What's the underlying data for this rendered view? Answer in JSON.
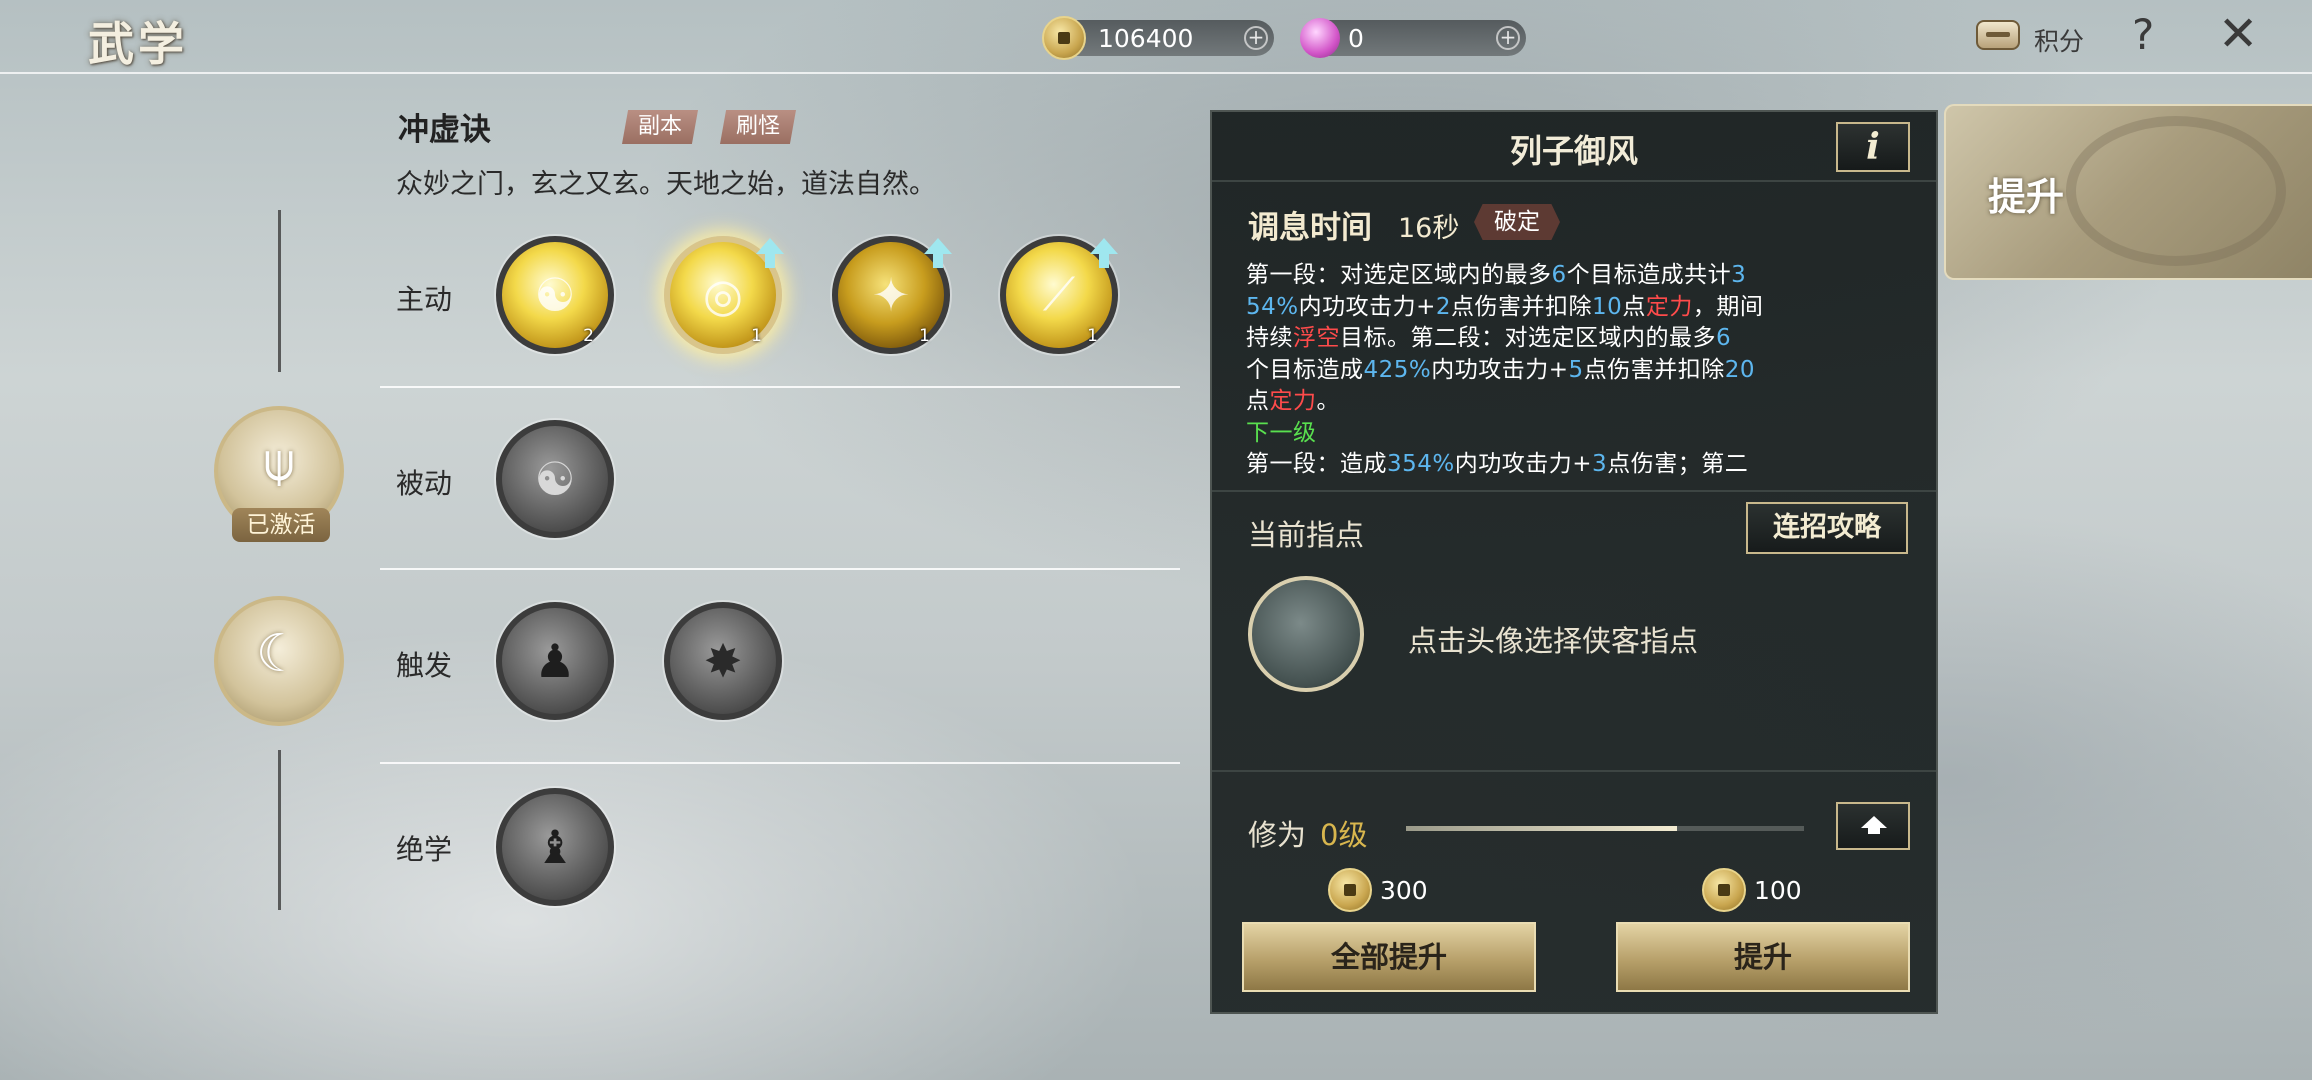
{
  "header": {
    "title": "武学",
    "coins": "106400",
    "gems": "0",
    "points_label": "积分",
    "help_label": "?",
    "close_label": "✕"
  },
  "skill_set": {
    "name": "冲虚诀",
    "tags": [
      "副本",
      "刷怪"
    ],
    "description": "众妙之门，玄之又玄。天地之始，道法自然。",
    "activated_label": "已激活"
  },
  "rows": {
    "active": {
      "label": "主动",
      "skills": [
        {
          "icon": "lightning-taichi-icon",
          "level": "2",
          "upgradable": false
        },
        {
          "icon": "golden-swirl-icon",
          "level": "1",
          "upgradable": true
        },
        {
          "icon": "golden-beast-icon",
          "level": "1",
          "upgradable": true
        },
        {
          "icon": "sword-slash-icon",
          "level": "1",
          "upgradable": true
        }
      ]
    },
    "passive": {
      "label": "被动",
      "skills": [
        {
          "icon": "yin-yang-icon"
        }
      ]
    },
    "trigger": {
      "label": "触发",
      "skills": [
        {
          "icon": "shadow-figure-icon"
        },
        {
          "icon": "cracked-rock-icon"
        }
      ]
    },
    "ultimate": {
      "label": "绝学",
      "skills": [
        {
          "icon": "meditating-master-icon"
        }
      ]
    }
  },
  "panel": {
    "title": "列子御风",
    "info_label": "i",
    "cooldown_label": "调息时间",
    "cooldown_value": "16秒",
    "break_tag": "破定",
    "description_lines": [
      [
        {
          "t": "第一段：对选定区域内的最多",
          "c": ""
        },
        {
          "t": "6",
          "c": "b"
        },
        {
          "t": "个目标造成共计",
          "c": ""
        },
        {
          "t": "3",
          "c": "b"
        }
      ],
      [
        {
          "t": "54%",
          "c": "b"
        },
        {
          "t": "内功攻击力+",
          "c": ""
        },
        {
          "t": "2",
          "c": "b"
        },
        {
          "t": "点伤害并扣除",
          "c": ""
        },
        {
          "t": "10",
          "c": "b"
        },
        {
          "t": "点",
          "c": ""
        },
        {
          "t": "定力",
          "c": "r"
        },
        {
          "t": "，期间",
          "c": ""
        }
      ],
      [
        {
          "t": "持续",
          "c": ""
        },
        {
          "t": "浮空",
          "c": "r"
        },
        {
          "t": "目标。第二段：对选定区域内的最多",
          "c": ""
        },
        {
          "t": "6",
          "c": "b"
        }
      ],
      [
        {
          "t": "个目标造成",
          "c": ""
        },
        {
          "t": "425%",
          "c": "b"
        },
        {
          "t": "内功攻击力+",
          "c": ""
        },
        {
          "t": "5",
          "c": "b"
        },
        {
          "t": "点伤害并扣除",
          "c": ""
        },
        {
          "t": "20",
          "c": "b"
        }
      ],
      [
        {
          "t": "点",
          "c": ""
        },
        {
          "t": "定力",
          "c": "r"
        },
        {
          "t": "。",
          "c": ""
        }
      ],
      [
        {
          "t": "下一级",
          "c": "g"
        }
      ],
      [
        {
          "t": "第一段：造成",
          "c": ""
        },
        {
          "t": "354%",
          "c": "b"
        },
        {
          "t": "内功攻击力+",
          "c": ""
        },
        {
          "t": "3",
          "c": "b"
        },
        {
          "t": "点伤害；第二",
          "c": ""
        }
      ]
    ],
    "guide_label": "当前指点",
    "combo_button": "连招攻略",
    "guide_hint": "点击头像选择侠客指点",
    "cultivation_label": "修为",
    "cultivation_value": "0级",
    "cultivation_progress": 0.68,
    "cost_all": "300",
    "cost_single": "100",
    "upgrade_all_button": "全部提升",
    "upgrade_button": "提升"
  },
  "side_tab": {
    "label": "提升"
  },
  "colors": {
    "accent_gold": "#c8b88c",
    "highlight_blue": "#5db6ee",
    "highlight_red": "#ff4b4b",
    "next_level_green": "#59e04f"
  }
}
